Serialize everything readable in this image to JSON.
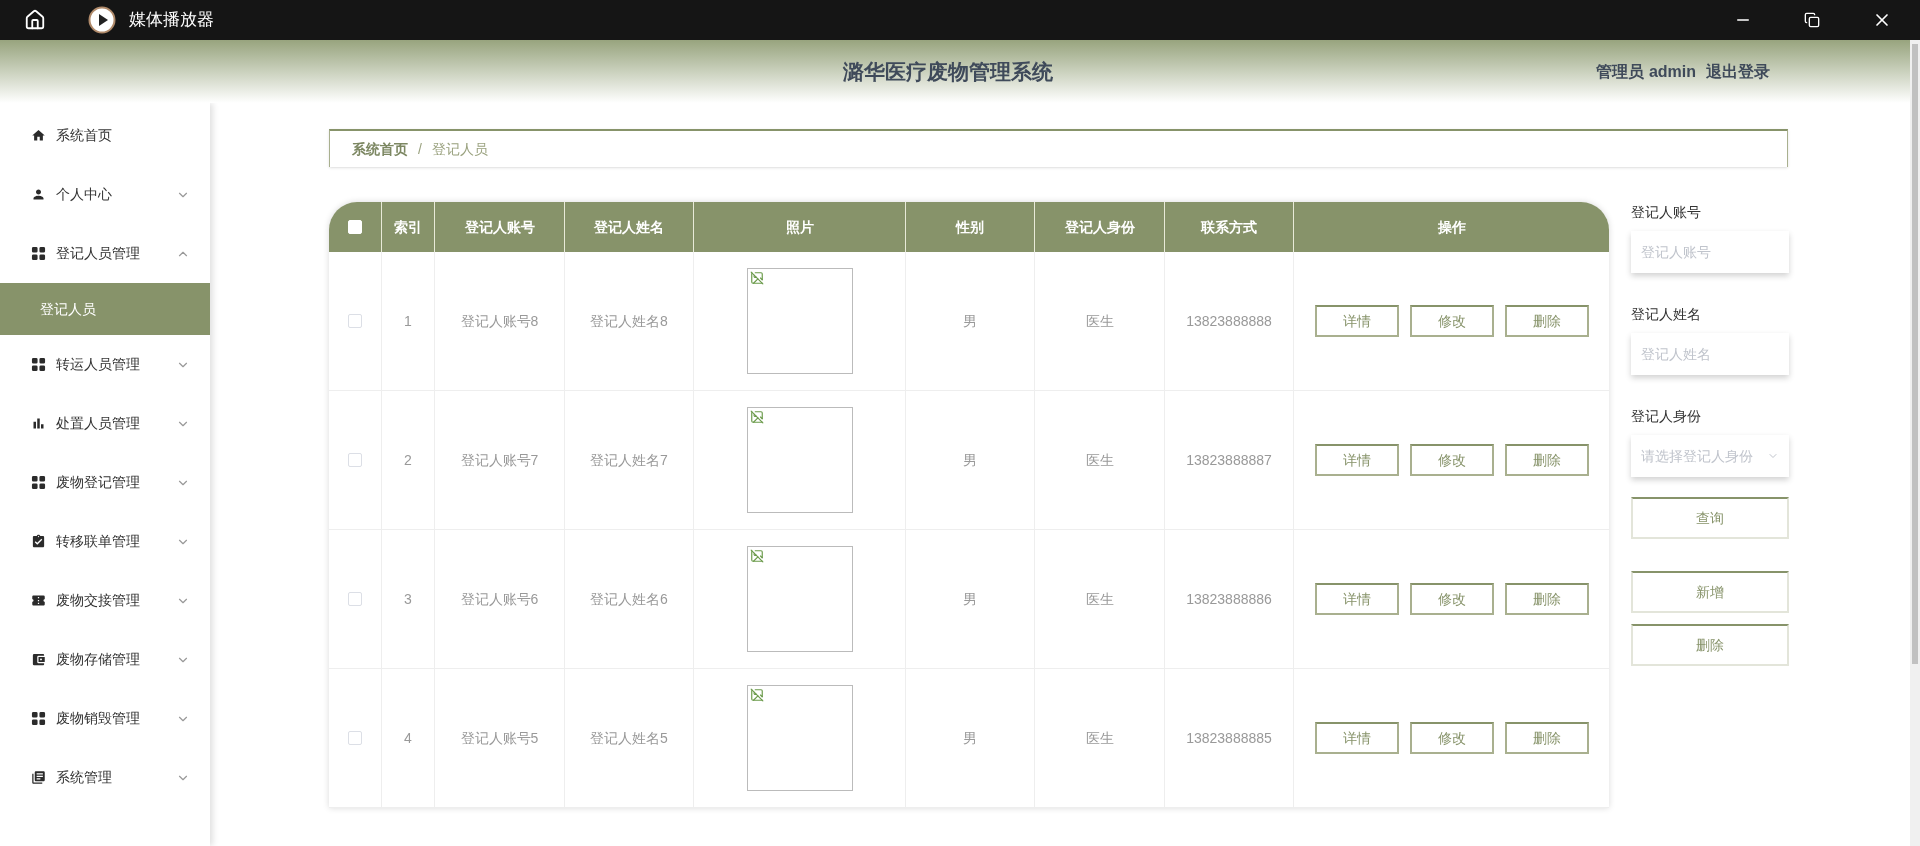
{
  "window": {
    "title": "媒体播放器"
  },
  "header": {
    "title": "潞华医疗废物管理系统",
    "user": "管理员 admin",
    "logout": "退出登录"
  },
  "sidebar": {
    "items": [
      {
        "label": "系统首页"
      },
      {
        "label": "个人中心",
        "expanded": false
      },
      {
        "label": "登记人员管理",
        "expanded": true,
        "children": [
          {
            "label": "登记人员",
            "selected": true
          }
        ]
      },
      {
        "label": "转运人员管理",
        "expanded": false
      },
      {
        "label": "处置人员管理",
        "expanded": false
      },
      {
        "label": "废物登记管理",
        "expanded": false
      },
      {
        "label": "转移联单管理",
        "expanded": false
      },
      {
        "label": "废物交接管理",
        "expanded": false
      },
      {
        "label": "废物存储管理",
        "expanded": false
      },
      {
        "label": "废物销毁管理",
        "expanded": false
      },
      {
        "label": "系统管理",
        "expanded": false
      }
    ]
  },
  "breadcrumb": [
    "系统首页",
    "/",
    "登记人员"
  ],
  "table": {
    "select_all_checked": false,
    "columns": [
      "索引",
      "登记人账号",
      "登记人姓名",
      "照片",
      "性别",
      "登记人身份",
      "联系方式",
      "操作"
    ],
    "rows": [
      {
        "checked": false,
        "index": "1",
        "account": "登记人账号8",
        "name": "登记人姓名8",
        "gender": "男",
        "role": "医生",
        "phone": "13823888888",
        "actions": [
          "详情",
          "修改",
          "删除"
        ]
      },
      {
        "checked": false,
        "index": "2",
        "account": "登记人账号7",
        "name": "登记人姓名7",
        "gender": "男",
        "role": "医生",
        "phone": "13823888887",
        "actions": [
          "详情",
          "修改",
          "删除"
        ]
      },
      {
        "checked": false,
        "index": "3",
        "account": "登记人账号6",
        "name": "登记人姓名6",
        "gender": "男",
        "role": "医生",
        "phone": "13823888886",
        "actions": [
          "详情",
          "修改",
          "删除"
        ]
      },
      {
        "checked": false,
        "index": "4",
        "account": "登记人账号5",
        "name": "登记人姓名5",
        "gender": "男",
        "role": "医生",
        "phone": "13823888885",
        "actions": [
          "详情",
          "修改",
          "删除"
        ]
      }
    ]
  },
  "search": {
    "fields": [
      {
        "kind": "input",
        "label": "登记人账号",
        "placeholder": "登记人账号"
      },
      {
        "kind": "input",
        "label": "登记人姓名",
        "placeholder": "登记人姓名"
      },
      {
        "kind": "select",
        "label": "登记人身份",
        "placeholder": "请选择登记人身份"
      }
    ],
    "buttons": [
      "查询",
      "新增",
      "删除"
    ]
  }
}
